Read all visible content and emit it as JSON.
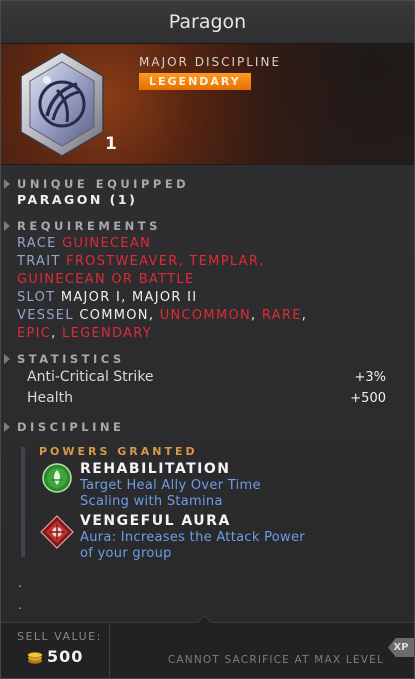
{
  "title": "Paragon",
  "header": {
    "kind": "MAJOR DISCIPLINE",
    "rarity": "LEGENDARY",
    "count": "1",
    "icon": "paragon-gem-icon",
    "rarity_color": "#f08a0e"
  },
  "unique_equipped": {
    "heading": "UNIQUE EQUIPPED",
    "value": "PARAGON (1)"
  },
  "requirements": {
    "heading": "REQUIREMENTS",
    "race_label": "RACE",
    "race_value": "GUINECEAN",
    "trait_label": "TRAIT",
    "trait_value_line1": "FROSTWEAVER, TEMPLAR,",
    "trait_value_line2": "GUINECEAN OR BATTLE",
    "slot_label": "SLOT",
    "slot_value": "MAJOR I, MAJOR II",
    "vessel_label": "VESSEL",
    "vessel_common": "COMMON",
    "vessel_uncommon": "UNCOMMON",
    "vessel_rare": "RARE",
    "vessel_epic": "EPIC",
    "vessel_legendary": "LEGENDARY",
    "comma": ","
  },
  "statistics": {
    "heading": "STATISTICS",
    "rows": [
      {
        "name": "Anti-Critical Strike",
        "value": "+3%"
      },
      {
        "name": "Health",
        "value": "+500"
      }
    ]
  },
  "discipline": {
    "heading": "DISCIPLINE",
    "powers_heading": "POWERS GRANTED",
    "powers": [
      {
        "name": "REHABILITATION",
        "desc_line1": "Target Heal Ally Over Time",
        "desc_line2": "Scaling with Stamina",
        "icon": "rehabilitation-icon"
      },
      {
        "name": "VENGEFUL AURA",
        "desc_line1": "Aura: Increases the Attack Power",
        "desc_line2": "of your group",
        "icon": "vengeful-aura-icon"
      }
    ],
    "dots": [
      ".",
      "."
    ]
  },
  "footer": {
    "sell_label": "SELL VALUE:",
    "sell_value": "500",
    "notice": "CANNOT SACRIFICE AT MAX LEVEL",
    "xp_label": "XP"
  },
  "colors": {
    "accent_blue": "#6c9ee6",
    "requirement_red": "#e02a35",
    "powers_gold": "#d59a48"
  }
}
